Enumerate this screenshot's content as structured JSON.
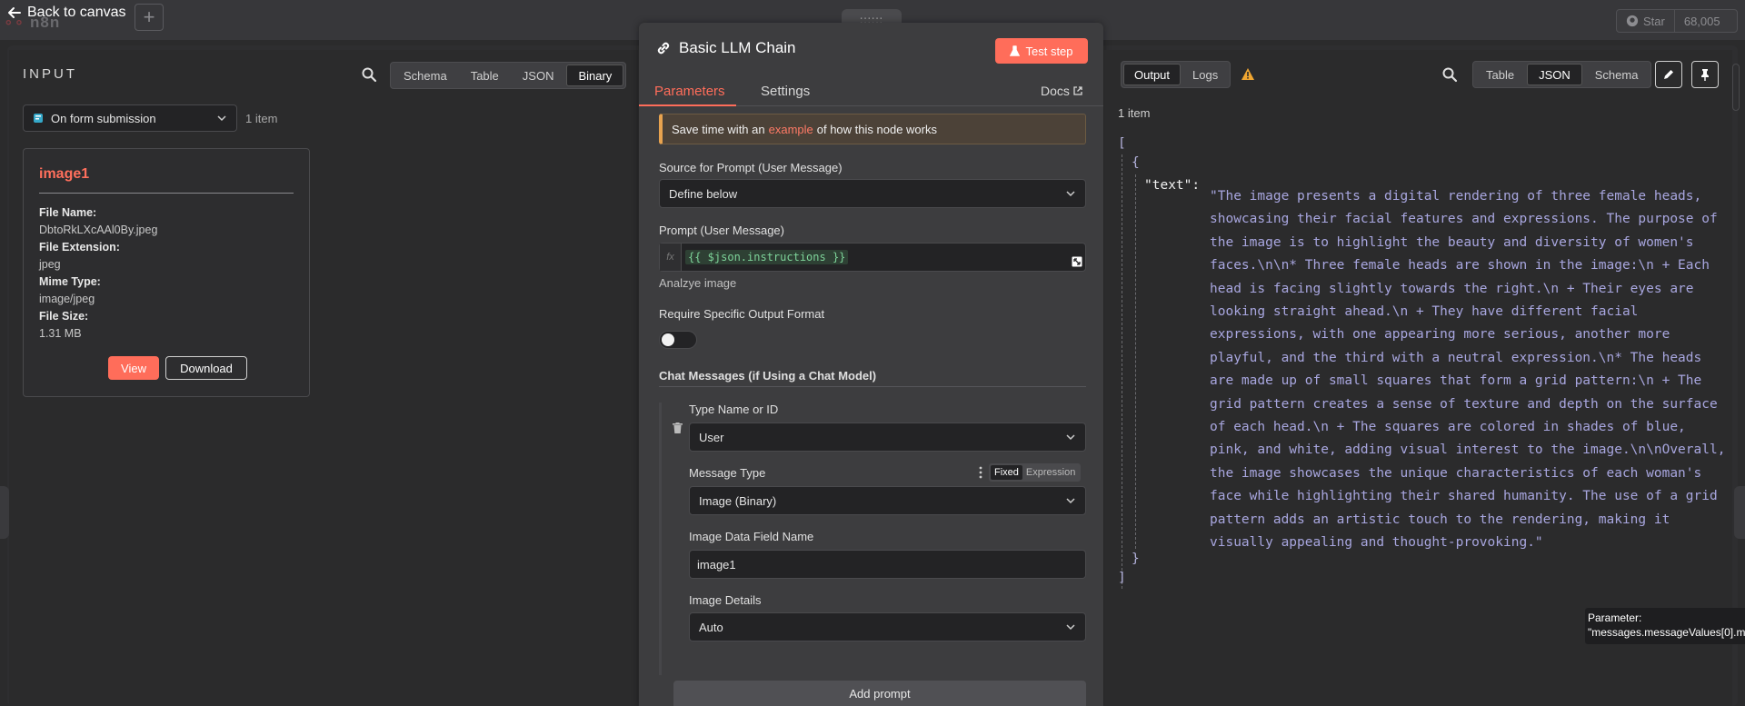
{
  "topbar": {
    "back_label": "Back to canvas",
    "logo_text": "n8n",
    "plus_label": "+",
    "github_star_label": "Star",
    "github_star_count": "68,005",
    "drag_handle": "::::::"
  },
  "input": {
    "title": "INPUT",
    "view_tabs": [
      "Schema",
      "Table",
      "JSON",
      "Binary"
    ],
    "active_view": "Binary",
    "source_node": "On form submission",
    "item_count": "1 item",
    "binary": {
      "name": "image1",
      "fields": [
        {
          "label": "File Name:",
          "value": "DbtoRkLXcAAl0By.jpeg"
        },
        {
          "label": "File Extension:",
          "value": "jpeg"
        },
        {
          "label": "Mime Type:",
          "value": "image/jpeg"
        },
        {
          "label": "File Size:",
          "value": "1.31 MB"
        }
      ],
      "view_label": "View",
      "download_label": "Download"
    }
  },
  "node": {
    "title": "Basic LLM Chain",
    "test_label": "Test step",
    "tabs": [
      "Parameters",
      "Settings"
    ],
    "active_tab": "Parameters",
    "docs_label": "Docs",
    "notice_prefix": "Save time with an",
    "notice_link": "example",
    "notice_suffix": "of how this node works",
    "source_label": "Source for Prompt (User Message)",
    "source_value": "Define below",
    "prompt_label": "Prompt (User Message)",
    "prompt_fx": "fx",
    "prompt_value": "{{ $json.instructions }}",
    "prompt_hint": "Analzye image",
    "require_format_label": "Require Specific Output Format",
    "require_format_on": false,
    "chat_messages_label": "Chat Messages (if Using a Chat Model)",
    "type_name_label": "Type Name or ID",
    "type_name_value": "User",
    "message_type_label": "Message Type",
    "mode_options": [
      "Fixed",
      "Expression"
    ],
    "active_mode": "Fixed",
    "message_type_value": "Image (Binary)",
    "image_field_label": "Image Data Field Name",
    "image_field_value": "image1",
    "image_details_label": "Image Details",
    "image_details_value": "Auto",
    "add_prompt_label": "Add prompt"
  },
  "output": {
    "tabs": [
      "Output",
      "Logs"
    ],
    "active_tab": "Output",
    "view_tabs": [
      "Table",
      "JSON",
      "Schema"
    ],
    "active_view": "JSON",
    "item_count": "1 item",
    "json_key": "\"text\":",
    "json_open": "[",
    "json_obj_open": "{",
    "json_obj_close": "}",
    "json_close": "]",
    "json_value": "\"The image presents a digital rendering of three female heads, showcasing their facial features and expressions. The purpose of the image is to highlight the beauty and diversity of women's faces.\\n\\n* Three female heads are shown in the image:\\n        + Each head is facing slightly towards the right.\\n        + Their eyes are looking straight ahead.\\n        + They have different facial expressions, with one appearing more serious, another more playful, and the third with a neutral expression.\\n* The heads are made up of small squares that form a grid pattern:\\n        + The grid pattern creates a sense of texture and depth on the surface of each head.\\n + The squares are colored in shades of blue, pink, and white, adding visual interest to the image.\\n\\nOverall, the image showcases the unique characteristics of each woman's face while highlighting their shared humanity. The use of a grid pattern adds an artistic touch to the rendering, making it visually appealing and thought-provoking.\""
  },
  "tooltip": {
    "line1": "Parameter:",
    "line2": "\"messages.messageValues[0].m"
  },
  "colors": {
    "accent": "#ff6d5a",
    "json_string": "#a8a6df",
    "panel": "#3d3d3f"
  }
}
